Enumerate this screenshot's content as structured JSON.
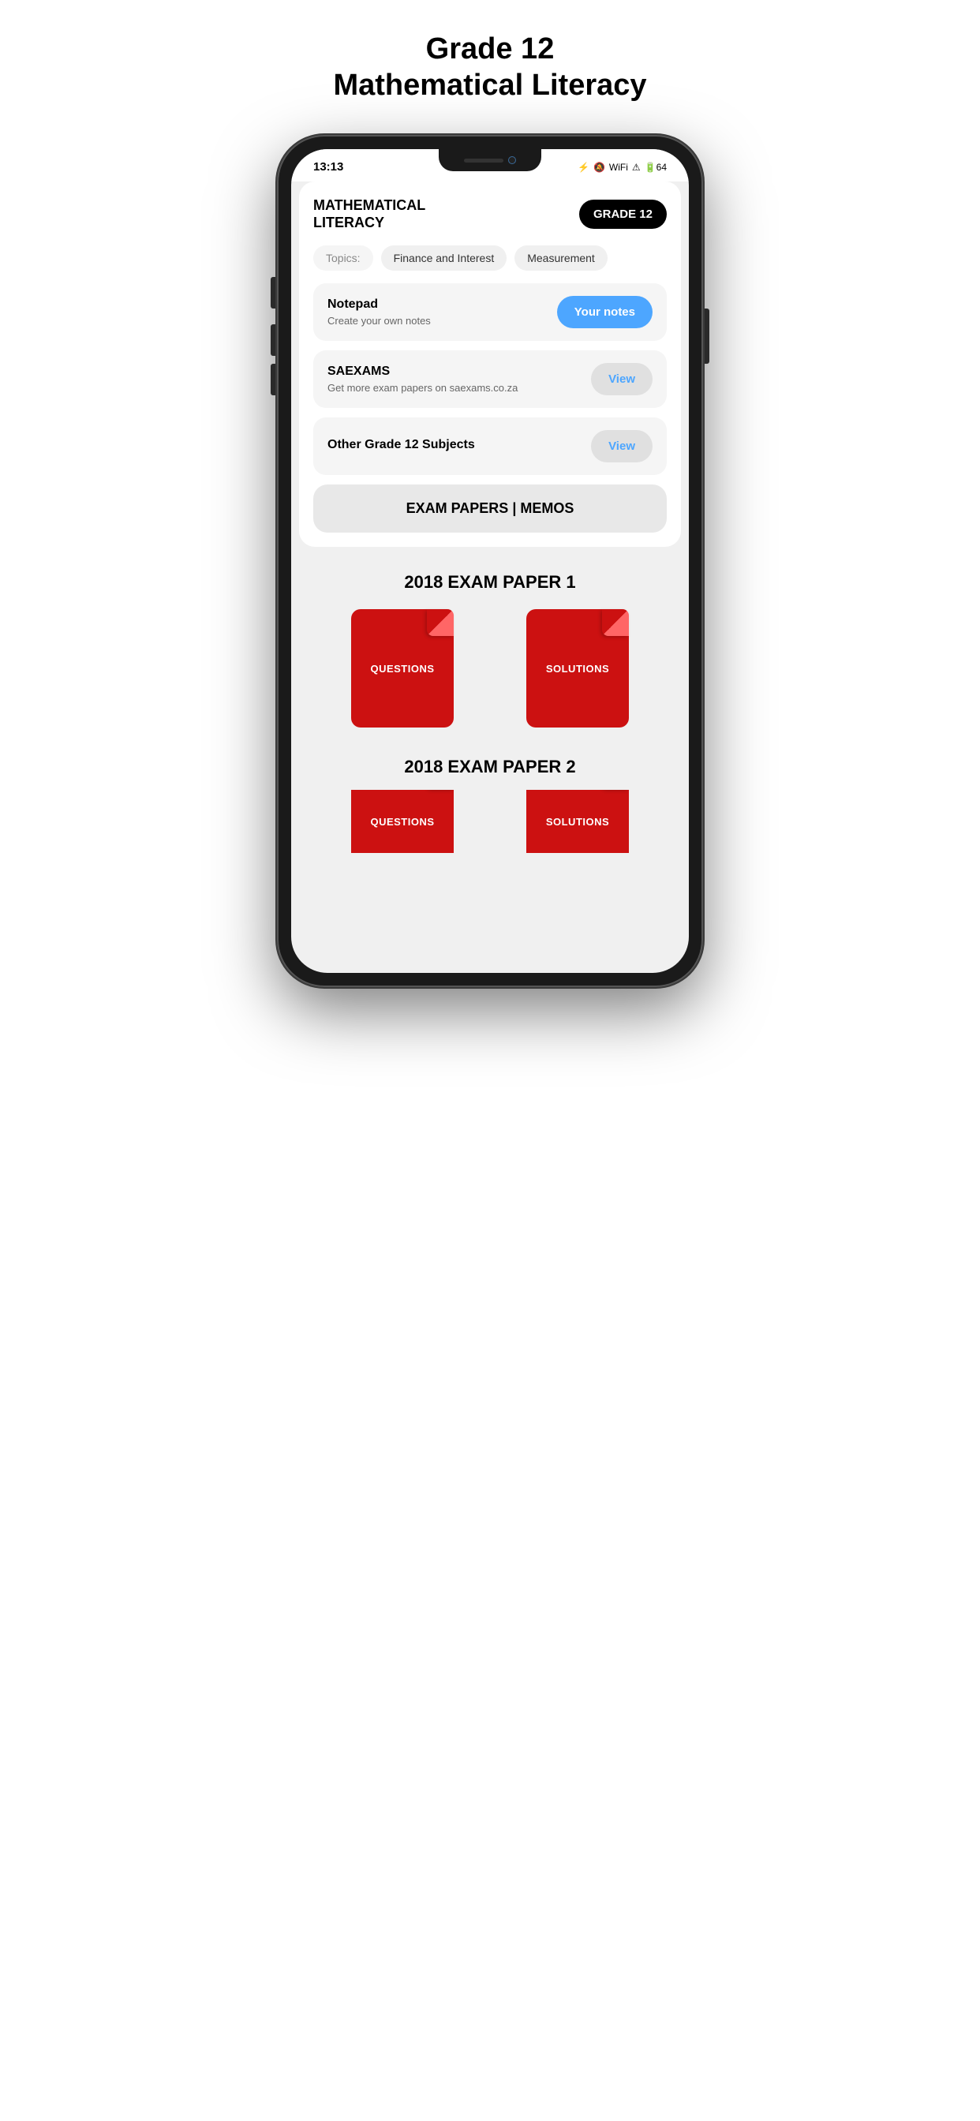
{
  "page": {
    "title_line1": "Grade 12",
    "title_line2": "Mathematical Literacy"
  },
  "status_bar": {
    "time": "13:13",
    "battery": "64"
  },
  "app": {
    "subject_title": "MATHEMATICAL\nLITERACY",
    "grade_badge": "GRADE 12",
    "topics_label": "Topics:",
    "topics": [
      {
        "label": "Finance and Interest"
      },
      {
        "label": "Measurement"
      }
    ],
    "notepad": {
      "title": "Notepad",
      "subtitle": "Create your own notes",
      "button": "Your notes"
    },
    "saexams": {
      "title": "SAEXAMS",
      "subtitle": "Get more exam papers on saexams.co.za",
      "button": "View"
    },
    "other_subjects": {
      "title": "Other Grade 12 Subjects",
      "button": "View"
    },
    "exam_papers_btn": "EXAM PAPERS | MEMOS",
    "exam_paper_1_title": "2018 EXAM PAPER 1",
    "exam_paper_2_title": "2018 EXAM PAPER 2",
    "doc1_label": "QUESTIONS",
    "doc2_label": "SOLUTIONS",
    "doc3_label": "QUESTIONS",
    "doc4_label": "SOLUTIONS"
  }
}
